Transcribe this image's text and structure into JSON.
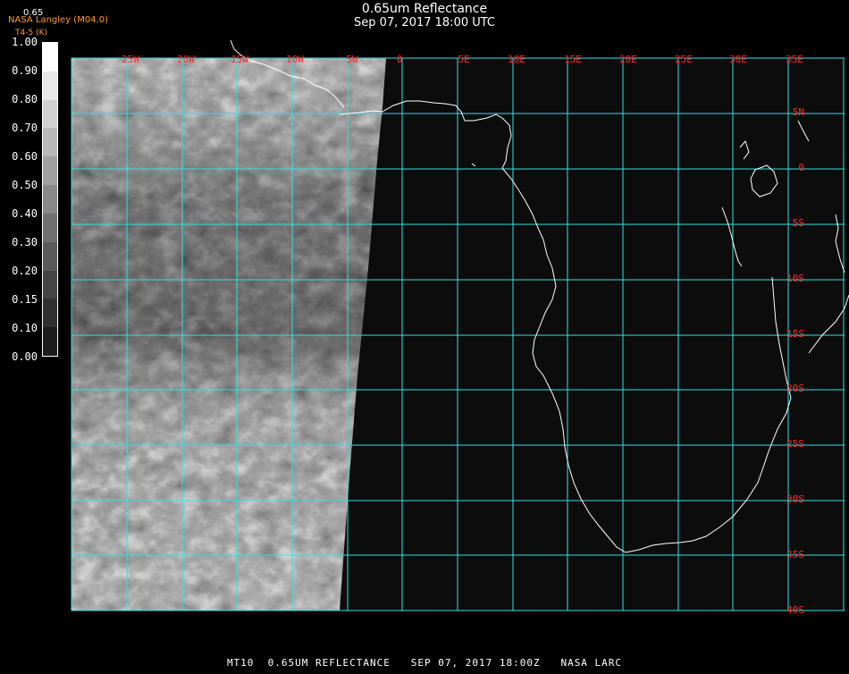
{
  "title": {
    "line1": "0.65um Reflectance",
    "line2": "Sep 07, 2017 18:00 UTC"
  },
  "header_small": {
    "band": "0.65",
    "org": "NASA Langley (M04.0)",
    "temp": "T4-5 (K)"
  },
  "colorbar": {
    "labels": [
      "1.00",
      "0.90",
      "0.80",
      "0.70",
      "0.60",
      "0.50",
      "0.40",
      "0.30",
      "0.20",
      "0.15",
      "0.10",
      "0.00"
    ],
    "shades": [
      "#ffffff",
      "#e8e8e8",
      "#d0d0d0",
      "#b8b8b8",
      "#a0a0a0",
      "#888888",
      "#707070",
      "#5a5a5a",
      "#444444",
      "#303030",
      "#1c1c1c"
    ]
  },
  "map": {
    "longitude_labels": [
      "25W",
      "20W",
      "15W",
      "10W",
      "5W",
      "0",
      "5E",
      "10E",
      "15E",
      "20E",
      "25E",
      "30E",
      "35E"
    ],
    "latitude_labels": [
      "5N",
      "0",
      "5S",
      "10S",
      "15S",
      "20S",
      "25S",
      "30S",
      "35S",
      "40S"
    ],
    "colors": {
      "grid": "#33e0e0",
      "coast": "#ffffff",
      "labels": "#ff2a2a",
      "background": "#0c0c0c"
    }
  },
  "footer": {
    "text": "MT10  0.65UM REFLECTANCE   SEP 07, 2017 18:00Z   NASA LARC"
  }
}
